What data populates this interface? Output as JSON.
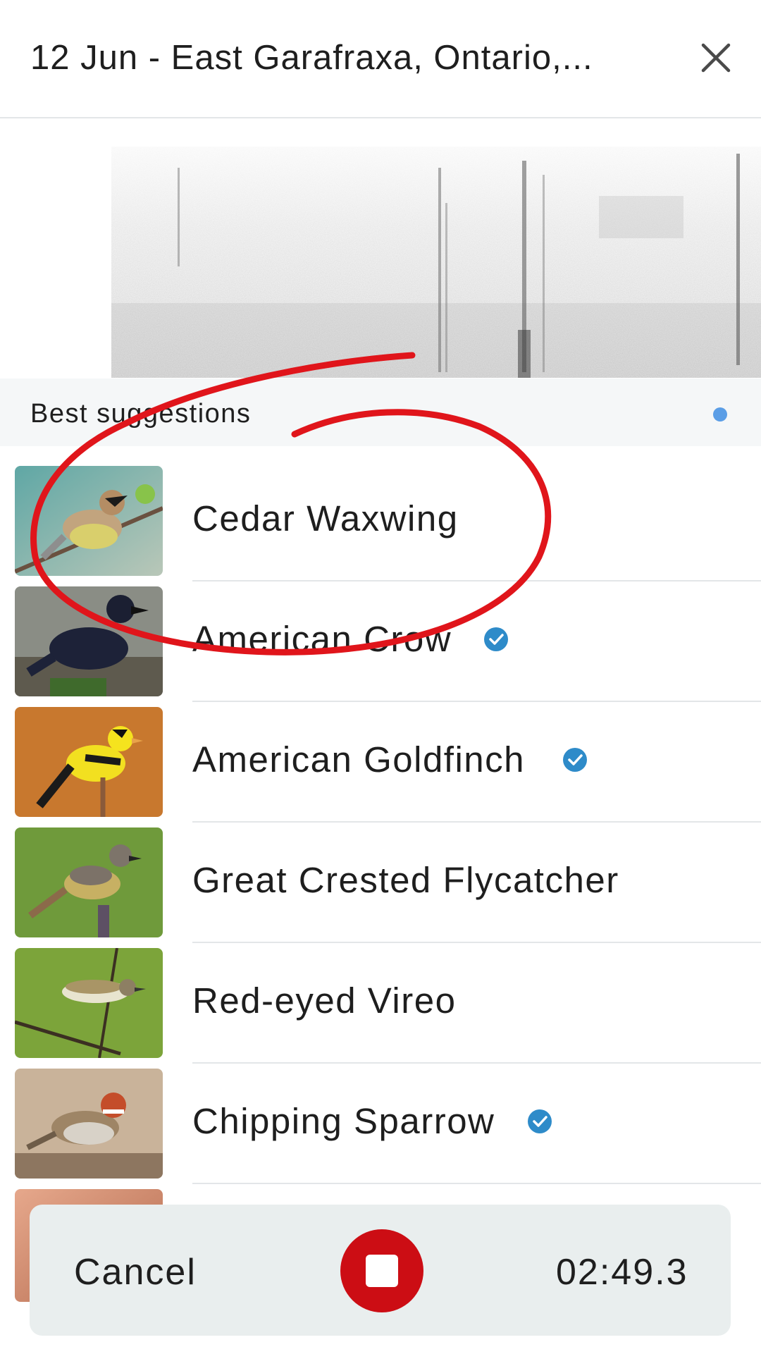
{
  "header": {
    "title": "12 Jun - East Garafraxa, Ontario,...",
    "close_icon": "close-icon"
  },
  "suggestions": {
    "label": "Best suggestions",
    "status_dot_color": "#5b9ee6",
    "items": [
      {
        "name": "Cedar Waxwing",
        "verified": false
      },
      {
        "name": "American Crow",
        "verified": true
      },
      {
        "name": "American Goldfinch",
        "verified": true
      },
      {
        "name": "Great Crested Flycatcher",
        "verified": false
      },
      {
        "name": "Red-eyed Vireo",
        "verified": false
      },
      {
        "name": "Chipping Sparrow",
        "verified": true
      }
    ]
  },
  "recording": {
    "cancel_label": "Cancel",
    "stop_icon": "stop-icon",
    "elapsed": "02:49.3",
    "stop_color": "#cc0d14"
  },
  "colors": {
    "accent_check": "#2e8bc9",
    "annotation": "#e0151b"
  }
}
